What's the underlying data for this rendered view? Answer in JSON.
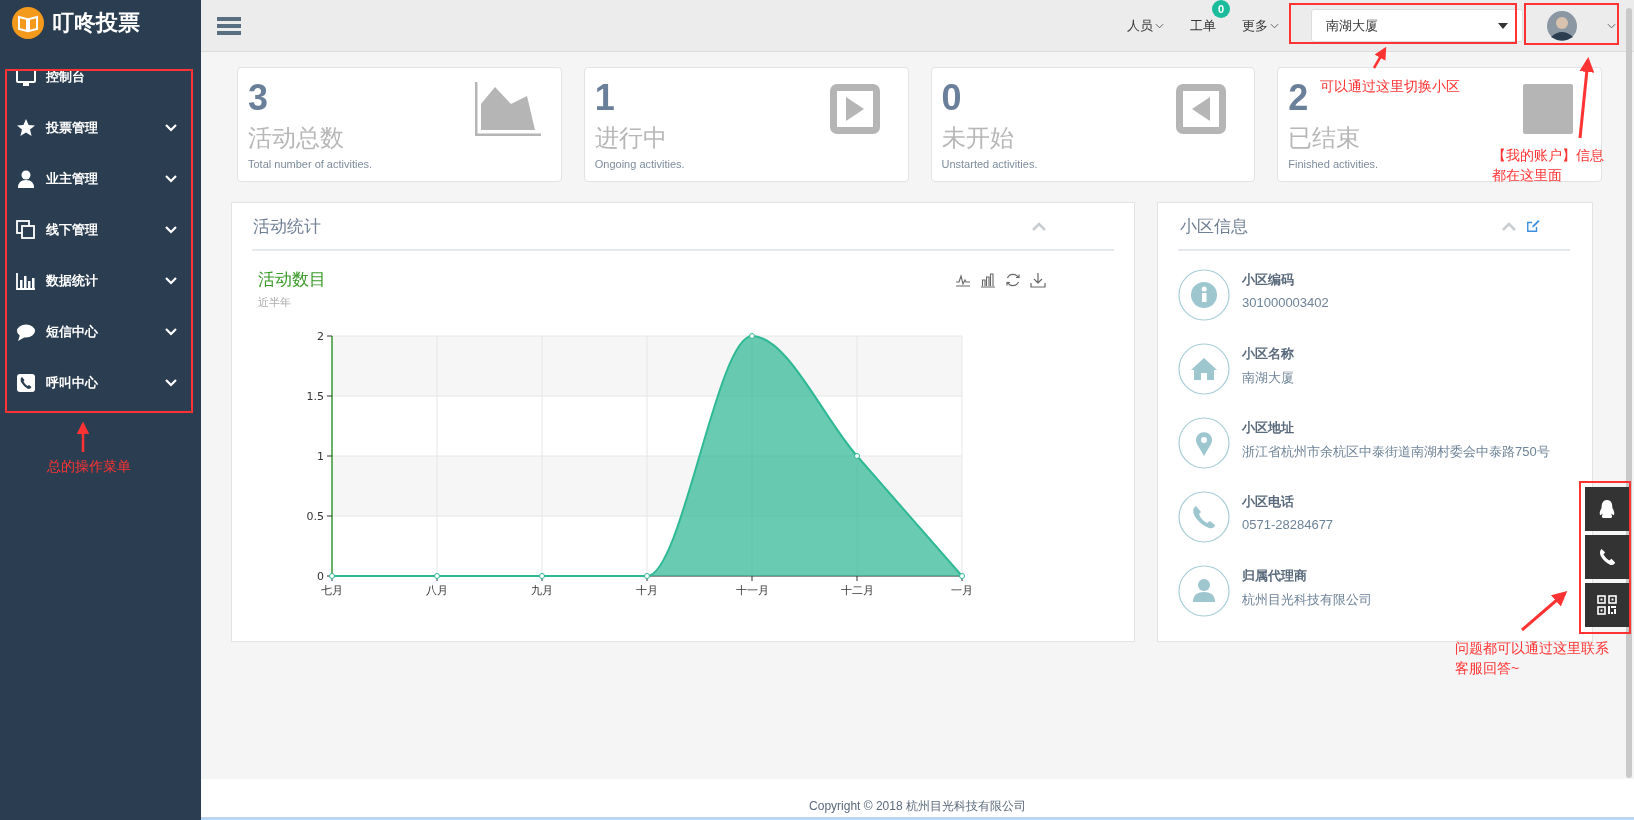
{
  "brand": {
    "title": "叮咚投票"
  },
  "sidebar": {
    "items": [
      {
        "label": "控制台",
        "has_submenu": false
      },
      {
        "label": "投票管理",
        "has_submenu": true
      },
      {
        "label": "业主管理",
        "has_submenu": true
      },
      {
        "label": "线下管理",
        "has_submenu": true
      },
      {
        "label": "数据统计",
        "has_submenu": true
      },
      {
        "label": "短信中心",
        "has_submenu": true
      },
      {
        "label": "呼叫中心",
        "has_submenu": true
      }
    ]
  },
  "topbar": {
    "nav": [
      {
        "label": "人员"
      },
      {
        "label": "工单",
        "badge": "0"
      },
      {
        "label": "更多"
      }
    ],
    "community_select": {
      "value": "南湖大厦"
    }
  },
  "stats": [
    {
      "value": "3",
      "title": "活动总数",
      "subtitle": "Total number of activities."
    },
    {
      "value": "1",
      "title": "进行中",
      "subtitle": "Ongoing activities."
    },
    {
      "value": "0",
      "title": "未开始",
      "subtitle": "Unstarted activities."
    },
    {
      "value": "2",
      "title": "已结束",
      "subtitle": "Finished activities."
    }
  ],
  "activity_panel": {
    "title": "活动统计",
    "chart_title": "活动数目",
    "chart_subtitle": "近半年",
    "chart_data": {
      "type": "area",
      "categories": [
        "七月",
        "八月",
        "九月",
        "十月",
        "十一月",
        "十二月",
        "一月"
      ],
      "series": [
        {
          "color": "#2fb894",
          "values": [
            0,
            0,
            0,
            0,
            2,
            1,
            0
          ]
        }
      ],
      "ylim": [
        0,
        2
      ],
      "yticks": [
        0,
        0.5,
        1,
        1.5,
        2
      ],
      "grid": true
    }
  },
  "community_panel": {
    "title": "小区信息",
    "items": [
      {
        "label": "小区编码",
        "value": "301000003402"
      },
      {
        "label": "小区名称",
        "value": "南湖大厦"
      },
      {
        "label": "小区地址",
        "value": "浙江省杭州市余杭区中泰街道南湖村委会中泰路750号"
      },
      {
        "label": "小区电话",
        "value": "0571-28284677"
      },
      {
        "label": "归属代理商",
        "value": "杭州目光科技有限公司"
      }
    ]
  },
  "footer": {
    "text": "Copyright © 2018 杭州目光科技有限公司"
  },
  "annotations": [
    {
      "lines": [
        "可以通过这里切换小区"
      ]
    },
    {
      "lines": [
        "【我的账户】信息",
        "都在这里面"
      ]
    },
    {
      "lines": [
        "总的操作菜单"
      ]
    },
    {
      "lines": [
        "问题都可以通过这里联系",
        "客服回答~"
      ]
    }
  ]
}
